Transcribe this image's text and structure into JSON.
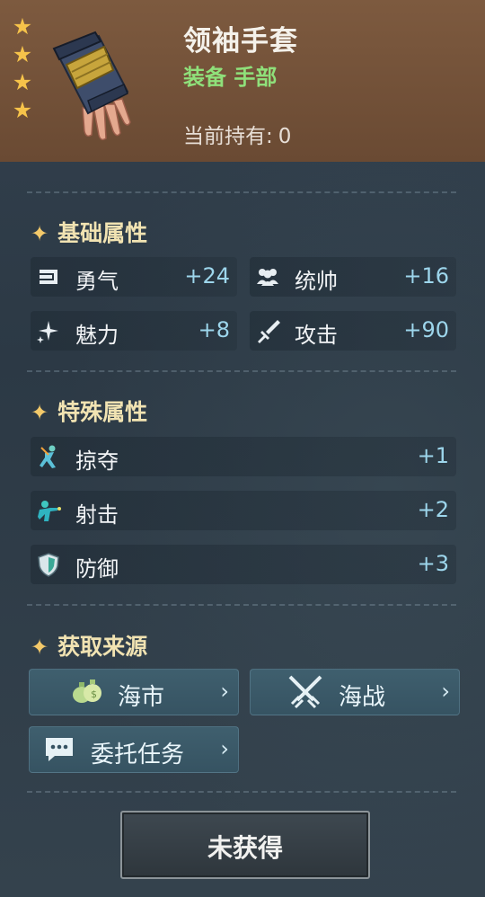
{
  "item": {
    "name": "领袖手套",
    "type": "装备  手部",
    "owned_label": "当前持有:",
    "owned_count": "0",
    "star_rating": 4,
    "star_glyph": "★"
  },
  "sections": {
    "base_title": "基础属性",
    "special_title": "特殊属性",
    "source_title": "获取来源",
    "title_glyph": "✦"
  },
  "base_stats": [
    {
      "label": "勇气",
      "value": "+24",
      "icon": "fist-icon"
    },
    {
      "label": "统帅",
      "value": "+16",
      "icon": "people-icon"
    },
    {
      "label": "魅力",
      "value": "+8",
      "icon": "sparkle-icon"
    },
    {
      "label": "攻击",
      "value": "+90",
      "icon": "sword-icon"
    }
  ],
  "special_stats": [
    {
      "label": "掠夺",
      "value": "+1",
      "icon": "plunder-icon"
    },
    {
      "label": "射击",
      "value": "+2",
      "icon": "shooter-icon"
    },
    {
      "label": "防御",
      "value": "+3",
      "icon": "shield-icon"
    }
  ],
  "sources": [
    {
      "label": "海市",
      "icon": "money-bags-icon"
    },
    {
      "label": "海战",
      "icon": "crossed-swords-icon"
    },
    {
      "label": "委托任务",
      "icon": "chat-bubble-icon"
    }
  ],
  "chevron": "›",
  "action_button": "未获得",
  "colors": {
    "header_bg": "#7d5a3f",
    "panel_bg": "#2c3a46",
    "star": "#f6c34a",
    "type_green": "#8fe07a",
    "stat_value": "#9dd6ec",
    "section_title": "#f1e3b2",
    "source_button": "#3f5f6e"
  }
}
